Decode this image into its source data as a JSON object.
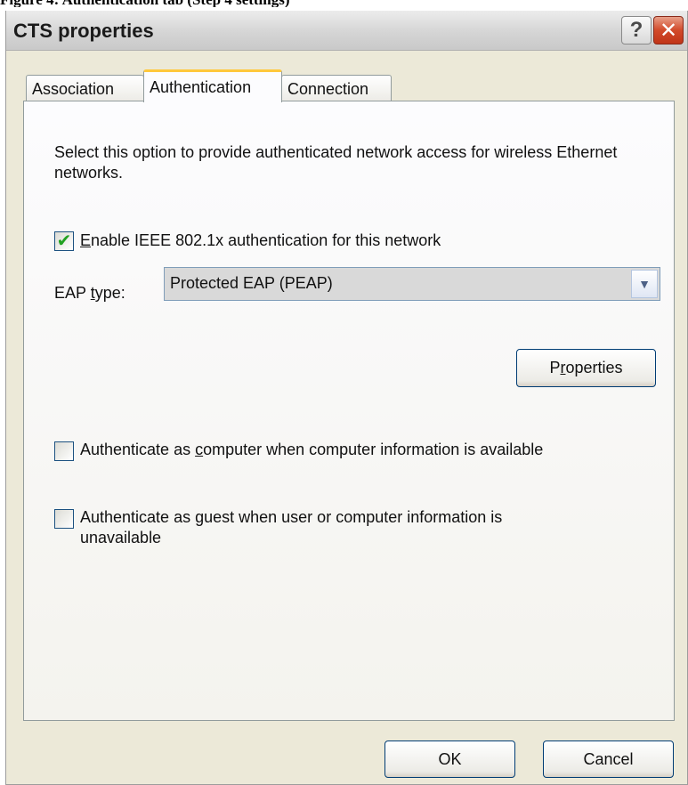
{
  "page_caption": "Figure 4: Authentication tab (Step 4 settings)",
  "window": {
    "title": "CTS properties",
    "help_symbol": "?",
    "close_symbol": "✕"
  },
  "tabs": [
    {
      "label": "Association",
      "active": false
    },
    {
      "label": "Authentication",
      "active": true
    },
    {
      "label": "Connection",
      "active": false
    }
  ],
  "authentication": {
    "description": "Select this option to provide authenticated network access for wireless Ethernet networks.",
    "enable_8021x": {
      "checked": true,
      "mnemonic": "E",
      "label_rest": "nable IEEE 802.1x authentication for this network"
    },
    "eap_type": {
      "label_prefix": "EAP ",
      "label_mnemonic": "t",
      "label_suffix": "ype:",
      "selected": "Protected EAP (PEAP)"
    },
    "properties_button": {
      "prefix": "P",
      "mnemonic": "r",
      "suffix": "operties"
    },
    "auth_as_computer": {
      "checked": false,
      "label_prefix": "Authenticate as ",
      "mnemonic": "c",
      "label_suffix": "omputer when computer information is available"
    },
    "auth_as_guest": {
      "checked": false,
      "label_prefix": "Authenticate as ",
      "mnemonic": "g",
      "label_suffix": "uest when user or computer information is unavailable"
    }
  },
  "footer": {
    "ok_label": "OK",
    "cancel_label": "Cancel"
  },
  "colors": {
    "dialog_bg": "#ece9d8",
    "active_tab_accent": "#ffc83c",
    "checkmark": "#21a121",
    "close_button": "#d24a2a"
  }
}
